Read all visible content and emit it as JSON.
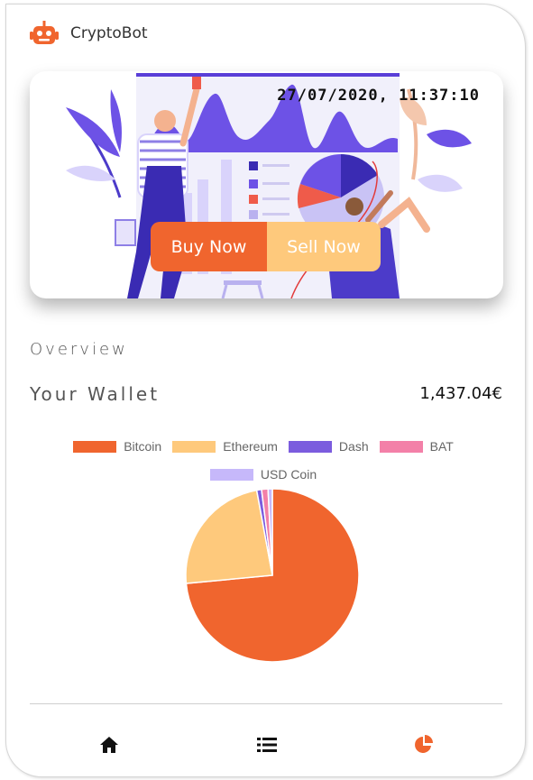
{
  "app": {
    "title": "CryptoBot",
    "icon": "robot-icon",
    "accent": "#f0652e"
  },
  "hero": {
    "datetime": "27/07/2020, 11:37:10",
    "buy_label": "Buy Now",
    "sell_label": "Sell Now",
    "buy_color": "#f0652e",
    "sell_color": "#fec97c"
  },
  "overview": {
    "section_label": "Overview",
    "wallet_label": "Your Wallet",
    "wallet_value": "1,437.04€"
  },
  "chart_data": {
    "type": "pie",
    "categories": [
      "Bitcoin",
      "Ethereum",
      "Dash",
      "BAT",
      "USD Coin"
    ],
    "values": [
      73.5,
      23.6,
      0.9,
      1.2,
      0.8
    ],
    "colors": [
      "#f0652e",
      "#fec97c",
      "#7b5cde",
      "#f380a8",
      "#c6b8fa"
    ],
    "legend_position": "top"
  },
  "nav": {
    "items": [
      {
        "icon": "home-icon",
        "active": false
      },
      {
        "icon": "list-icon",
        "active": false
      },
      {
        "icon": "pie-chart-icon",
        "active": true
      }
    ],
    "active_color": "#f0652e",
    "inactive_color": "#111111"
  }
}
